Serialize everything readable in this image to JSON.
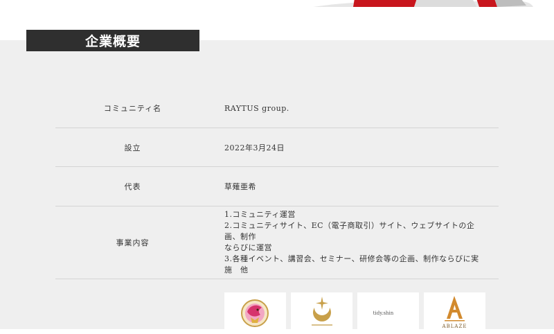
{
  "section": {
    "title": "企業概要"
  },
  "company_info": {
    "rows": [
      {
        "label": "コミュニティ名",
        "value": "RAYTUS group."
      },
      {
        "label": "設立",
        "value": "2022年3月24日"
      },
      {
        "label": "代表",
        "value": "草薙亜希"
      },
      {
        "label": "事業内容",
        "lines": [
          "1.コミュニティ運営",
          "2.コミュニティサイト、EC（電子商取引）サイト、ウェブサイトの企画、制作",
          "ならびに運営",
          "3.各種イベント、講習会、セミナー、研修会等の企画、制作ならびに実施　他"
        ]
      }
    ]
  },
  "logos": [
    {
      "icon": "dragon-emblem-logo-icon",
      "text": ""
    },
    {
      "icon": "crescent-star-logo-icon",
      "text": ""
    },
    {
      "icon": "crescent-moon-logo-icon",
      "text": "tidy.shin"
    },
    {
      "icon": "letter-a-logo-icon",
      "text": "ABLAZE"
    }
  ],
  "colors": {
    "title_bar": "#2f2f2f",
    "section_bg": "#efefef",
    "divider": "#d4d4d4",
    "accent_red": "#c8161d",
    "gold": "#c8a04a",
    "navy": "#1e2a5a"
  }
}
